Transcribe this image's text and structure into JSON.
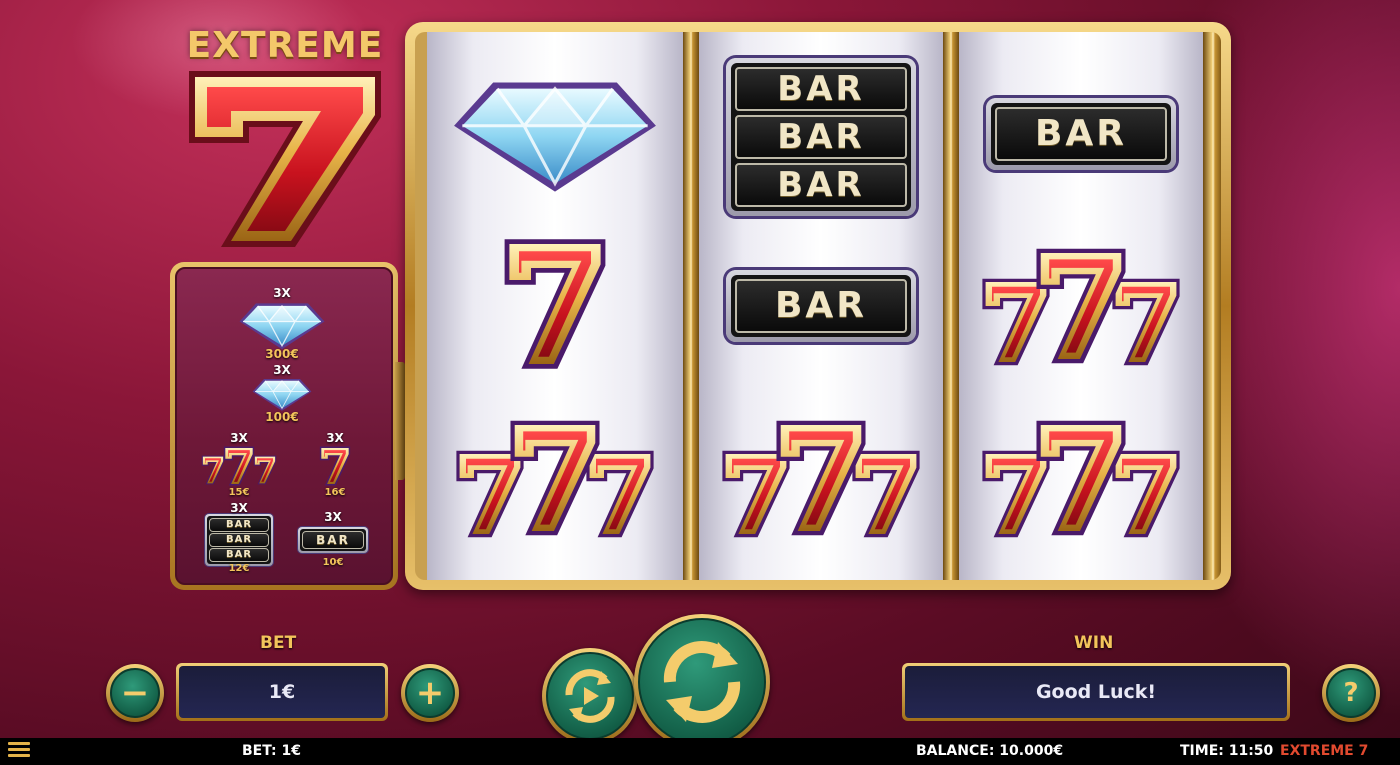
{
  "game": {
    "logo_top": "EXTREME",
    "logo_number": "7"
  },
  "paytable": {
    "items": [
      {
        "symbol": "diamond",
        "multiplier": "3X",
        "payout": "300€"
      },
      {
        "symbol": "small-diamond",
        "multiplier": "3X",
        "payout": "100€"
      },
      {
        "symbol": "triple-seven",
        "multiplier": "3X",
        "payout": "15€"
      },
      {
        "symbol": "single-seven",
        "multiplier": "3X",
        "payout": "16€"
      },
      {
        "symbol": "triple-bar",
        "multiplier": "3X",
        "payout": "12€"
      },
      {
        "symbol": "single-bar",
        "multiplier": "3X",
        "payout": "10€"
      }
    ]
  },
  "reels": [
    [
      "diamond",
      "single-seven",
      "triple-seven"
    ],
    [
      "triple-bar",
      "single-bar",
      "triple-seven"
    ],
    [
      "single-bar",
      "triple-seven",
      "triple-seven"
    ]
  ],
  "symbol_text": {
    "bar": "BAR",
    "seven": "7"
  },
  "controls": {
    "bet_label": "BET",
    "bet_value": "1€",
    "minus_label": "−",
    "plus_label": "+",
    "win_label": "WIN",
    "win_value": "Good Luck!",
    "help_label": "?"
  },
  "status_bar": {
    "bet": "BET: 1€",
    "balance": "BALANCE: 10.000€",
    "time": "TIME: 11:50",
    "game_name": "EXTREME 7"
  },
  "colors": {
    "gold": "#f3c45b",
    "seven_red": "#d0222c",
    "button_green": "#1a7a5c",
    "accent_red": "#e14a2f"
  }
}
